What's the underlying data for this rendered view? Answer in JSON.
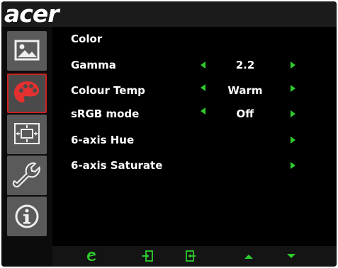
{
  "brand": {
    "logo_text": "acer"
  },
  "sidebar": {
    "items": [
      {
        "name": "picture",
        "icon": "picture-icon",
        "active": false
      },
      {
        "name": "color",
        "icon": "palette-icon",
        "active": true
      },
      {
        "name": "osd",
        "icon": "osd-position-icon",
        "active": false
      },
      {
        "name": "setup",
        "icon": "wrench-icon",
        "active": false
      },
      {
        "name": "information",
        "icon": "info-icon",
        "active": false
      }
    ]
  },
  "menu": {
    "title": "Color",
    "rows": [
      {
        "label": "Gamma",
        "value": "2.2",
        "left_arrow": true,
        "right_arrow": true
      },
      {
        "label": "Colour Temp",
        "value": "Warm",
        "left_arrow": true,
        "right_arrow": true
      },
      {
        "label": "sRGB mode",
        "value": "Off",
        "left_arrow": true,
        "right_arrow": true
      },
      {
        "label": "6-axis Hue",
        "value": "",
        "left_arrow": false,
        "right_arrow": true
      },
      {
        "label": "6-axis Saturate",
        "value": "",
        "left_arrow": false,
        "right_arrow": true
      }
    ]
  },
  "bottom_bar": {
    "buttons": [
      {
        "name": "empowering",
        "icon": "e-icon"
      },
      {
        "name": "exit",
        "icon": "exit-icon"
      },
      {
        "name": "enter",
        "icon": "enter-icon"
      },
      {
        "name": "up",
        "icon": "triangle-up-icon"
      },
      {
        "name": "down",
        "icon": "triangle-down-icon"
      }
    ]
  },
  "colors": {
    "accent_green": "#2ecc2e",
    "active_red": "#cc2222",
    "background": "#000000",
    "sidebar_button": "#5a5a5a"
  }
}
